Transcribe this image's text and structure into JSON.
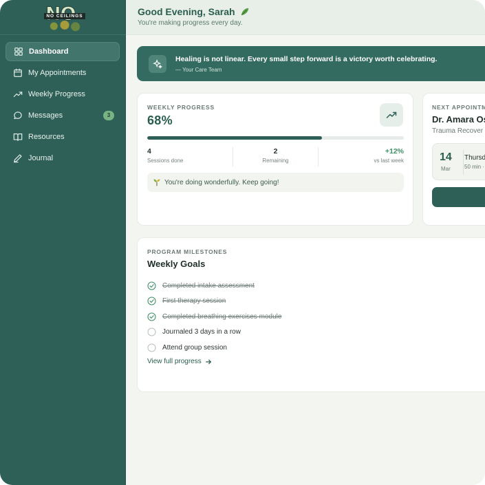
{
  "brand": {
    "logo_text": "NO CEILINGS",
    "logo_word": "NO"
  },
  "sidebar": {
    "items": [
      {
        "label": "Dashboard",
        "icon": "grid-icon",
        "active": true
      },
      {
        "label": "My Appointments",
        "icon": "calendar-icon"
      },
      {
        "label": "Weekly Progress",
        "icon": "trending-up-icon"
      },
      {
        "label": "Messages",
        "icon": "chat-bubble-icon",
        "badge": "3"
      },
      {
        "label": "Resources",
        "icon": "open-book-icon"
      },
      {
        "label": "Journal",
        "icon": "pencil-icon"
      }
    ]
  },
  "header": {
    "greeting": "Good Evening, Sarah",
    "subtitle": "You're making progress every day."
  },
  "banner": {
    "quote": "Healing is not linear. Every small step forward is a victory worth celebrating.",
    "signature": "— Your Care Team"
  },
  "progress": {
    "label": "WEEKLY PROGRESS",
    "percent_text": "68%",
    "percent": 68,
    "stats": [
      {
        "value": "4",
        "caption": "Sessions done"
      },
      {
        "value": "2",
        "caption": "Remaining"
      },
      {
        "value": "+12%",
        "caption": "vs last week"
      }
    ],
    "encouragement": "You're doing wonderfully. Keep going!"
  },
  "appointment": {
    "label": "NEXT APPOINTMENT",
    "doctor": "Dr. Amara Os",
    "specialty": "Trauma Recover",
    "day": "14",
    "month": "Mar",
    "weekday": "Thursday",
    "duration": "50 min ·"
  },
  "milestones": {
    "label": "PROGRAM MILESTONES",
    "title": "Weekly Goals",
    "goals": [
      {
        "text": "Completed intake assessment",
        "done": true
      },
      {
        "text": "First therapy session",
        "done": true
      },
      {
        "text": "Completed breathing exercises module",
        "done": true
      },
      {
        "text": "Journaled 3 days in a row",
        "done": false
      },
      {
        "text": "Attend group session",
        "done": false
      }
    ],
    "link": "View full progress"
  },
  "colors": {
    "primary": "#2f6058",
    "accent": "#3f9066",
    "background": "#f3f5f1"
  }
}
